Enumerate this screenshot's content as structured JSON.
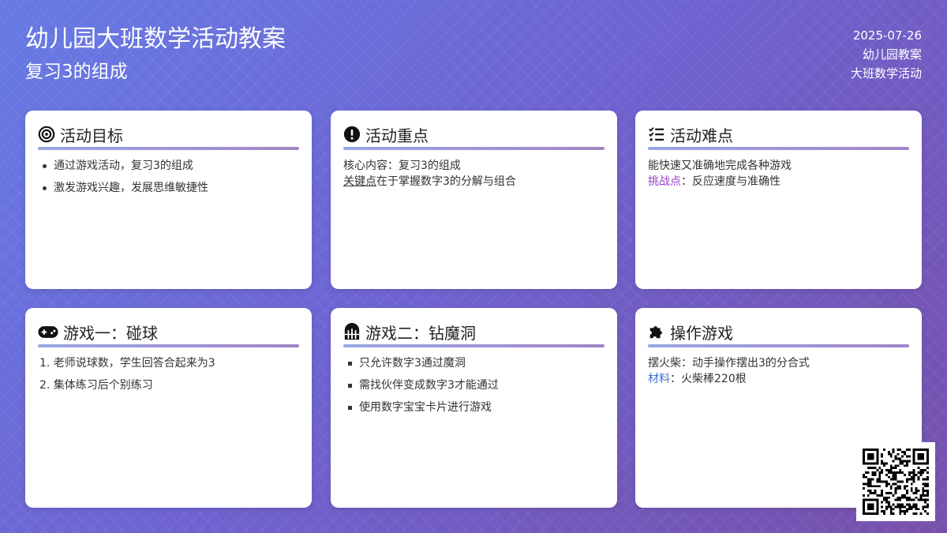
{
  "header": {
    "title": "幼儿园大班数学活动教案",
    "subtitle": "复习3的组成"
  },
  "meta": {
    "date": "2025-07-26",
    "line1": "幼儿园教案",
    "line2": "大班数学活动"
  },
  "cards": {
    "goals": {
      "icon": "target-icon",
      "title": "活动目标",
      "items": [
        "通过游戏活动，复习3的组成",
        "激发游戏兴趣，发展思维敏捷性"
      ]
    },
    "focus": {
      "icon": "exclamation-icon",
      "title": "活动重点",
      "line1": "核心内容：复习3的组成",
      "key_label": "关键点",
      "key_text": "在于掌握数字3的分解与组合"
    },
    "difficulty": {
      "icon": "checklist-icon",
      "title": "活动难点",
      "line1": "能快速又准确地完成各种游戏",
      "challenge_label": "挑战点",
      "challenge_text": "：反应速度与准确性"
    },
    "game1": {
      "icon": "gamepad-icon",
      "title": "游戏一：碰球",
      "items": [
        "1. 老师说球数，学生回答合起来为3",
        "2. 集体练习后个别练习"
      ]
    },
    "game2": {
      "icon": "gate-icon",
      "title": "游戏二：钻魔洞",
      "items": [
        "只允许数字3通过魔洞",
        "需找伙伴变成数字3才能通过",
        "使用数字宝宝卡片进行游戏"
      ]
    },
    "operate": {
      "icon": "puzzle-icon",
      "title": "操作游戏",
      "line1": "摆火柴：动手操作摆出3的分合式",
      "material_label": "材料",
      "material_text": "：火柴棒220根"
    }
  },
  "colors": {
    "accent_purple": "#9a3fc8",
    "accent_blue": "#3d6fd0",
    "bg_start": "#667ae4",
    "bg_end": "#7650aa"
  },
  "qr_icon": "qr-code-icon"
}
